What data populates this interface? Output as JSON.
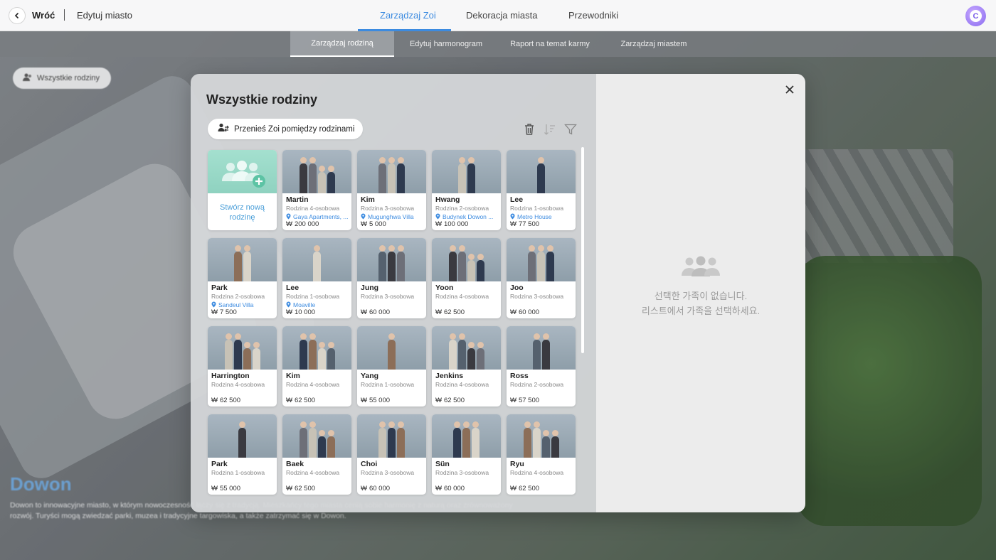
{
  "background": {
    "filter_pill": "Wszystkie rodziny",
    "city_name": "Dowon",
    "city_description": "Dowon to innowacyjne miasto, w którym nowoczesność łączy się z tradycją. Mieszkańcy tego miasta cenią sobie harmonię z naturą oraz zrównoważony rozwój. Turyści mogą zwiedzać parki, muzea i tradycyjne targowiska, a także zatrzymać się w Dowon."
  },
  "topbar": {
    "back_label": "Wróć",
    "edit_city_label": "Edytuj miasto",
    "tabs": [
      "Zarządzaj Zoi",
      "Dekoracja miasta",
      "Przewodniki"
    ],
    "active_tab": "Zarządzaj Zoi",
    "avatar_letter": "C"
  },
  "subtabs": {
    "items": [
      "Zarządzaj rodziną",
      "Edytuj harmonogram",
      "Raport na temat karmy",
      "Zarządzaj miastem"
    ],
    "active": "Zarządzaj rodziną"
  },
  "modal": {
    "title": "Wszystkie rodziny",
    "move_button": "Przenieś Zoi pomiędzy rodzinami",
    "new_family_label": "Stwórz nową rodzinę",
    "currency_symbol": "₩",
    "empty_state": {
      "line1": "선택한 가족이 없습니다.",
      "line2": "리스트에서 가족을 선택하세요."
    },
    "families": [
      {
        "name": "Martin",
        "size": "Rodzina 4-osobowa",
        "location": "Gaya Apartments, ...",
        "money": "200 000"
      },
      {
        "name": "Kim",
        "size": "Rodzina 3-osobowa",
        "location": "Mugunghwa Villa",
        "money": "5 000"
      },
      {
        "name": "Hwang",
        "size": "Rodzina 2-osobowa",
        "location": "Budynek Dowon ...",
        "money": "100 000"
      },
      {
        "name": "Lee",
        "size": "Rodzina 1-osobowa",
        "location": "Metro House",
        "money": "77 500"
      },
      {
        "name": "Park",
        "size": "Rodzina 2-osobowa",
        "location": "Sandeul Villa",
        "money": "7 500"
      },
      {
        "name": "Lee",
        "size": "Rodzina 1-osobowa",
        "location": "Moaville",
        "money": "10 000"
      },
      {
        "name": "Jung",
        "size": "Rodzina 3-osobowa",
        "location": "",
        "money": "60 000"
      },
      {
        "name": "Yoon",
        "size": "Rodzina 4-osobowa",
        "location": "",
        "money": "62 500"
      },
      {
        "name": "Joo",
        "size": "Rodzina 3-osobowa",
        "location": "",
        "money": "60 000"
      },
      {
        "name": "Harrington",
        "size": "Rodzina 4-osobowa",
        "location": "",
        "money": "62 500"
      },
      {
        "name": "Kim",
        "size": "Rodzina 4-osobowa",
        "location": "",
        "money": "62 500"
      },
      {
        "name": "Yang",
        "size": "Rodzina 1-osobowa",
        "location": "",
        "money": "55 000"
      },
      {
        "name": "Jenkins",
        "size": "Rodzina 4-osobowa",
        "location": "",
        "money": "62 500"
      },
      {
        "name": "Ross",
        "size": "Rodzina 2-osobowa",
        "location": "",
        "money": "57 500"
      },
      {
        "name": "Park",
        "size": "Rodzina 1-osobowa",
        "location": "",
        "money": "55 000"
      },
      {
        "name": "Baek",
        "size": "Rodzina 4-osobowa",
        "location": "",
        "money": "62 500"
      },
      {
        "name": "Choi",
        "size": "Rodzina 3-osobowa",
        "location": "",
        "money": "60 000"
      },
      {
        "name": "Sün",
        "size": "Rodzina 3-osobowa",
        "location": "",
        "money": "60 000"
      },
      {
        "name": "Ryu",
        "size": "Rodzina 4-osobowa",
        "location": "",
        "money": "62 500"
      }
    ]
  },
  "icons": {
    "back": "chevron-left-icon",
    "move": "people-swap-icon",
    "delete": "trash-icon",
    "sort": "sort-icon",
    "filter": "filter-icon",
    "close": "close-icon",
    "location": "pin-icon",
    "empty": "people-group-icon"
  },
  "colors": {
    "accent": "#3c8be0",
    "new_family_tile": "#9fdccb"
  }
}
